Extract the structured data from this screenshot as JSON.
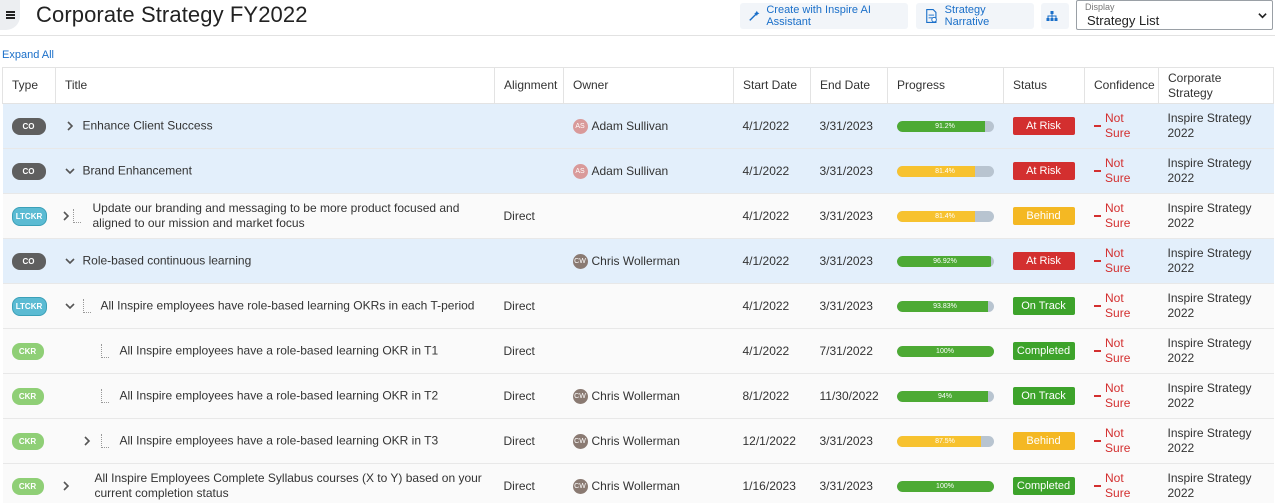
{
  "header": {
    "title": "Corporate Strategy FY2022",
    "ai_button": "Create with Inspire AI Assistant",
    "narrative_button": "Strategy Narrative",
    "display_label": "Display",
    "display_value": "Strategy List"
  },
  "expand_all": "Expand All",
  "columns": [
    "Type",
    "Title",
    "Alignment",
    "Owner",
    "Start Date",
    "End Date",
    "Progress",
    "Status",
    "Confidence",
    "Corporate Strategy"
  ],
  "rows": [
    {
      "type": "CO",
      "title": "Enhance Client Success",
      "alignment": "",
      "owner": "Adam Sullivan",
      "owner_initials": "AS",
      "start": "4/1/2022",
      "end": "3/31/2023",
      "progress_label": "91.2%",
      "progress": 0.912,
      "status": "At Risk",
      "confidence": "Not Sure",
      "strategy": "Inspire Strategy 2022"
    },
    {
      "type": "CO",
      "title": "Brand Enhancement",
      "alignment": "",
      "owner": "Adam Sullivan",
      "owner_initials": "AS",
      "start": "4/1/2022",
      "end": "3/31/2023",
      "progress_label": "81.4%",
      "progress": 0.814,
      "status": "At Risk",
      "confidence": "Not Sure",
      "strategy": "Inspire Strategy 2022"
    },
    {
      "type": "LTCKR",
      "title": "Update our branding and messaging to be more product focused and aligned to our mission and market focus",
      "alignment": "Direct",
      "owner": "",
      "owner_initials": "",
      "start": "4/1/2022",
      "end": "3/31/2023",
      "progress_label": "81.4%",
      "progress": 0.814,
      "status": "Behind",
      "confidence": "Not Sure",
      "strategy": "Inspire Strategy 2022"
    },
    {
      "type": "CO",
      "title": "Role-based continuous learning",
      "alignment": "",
      "owner": "Chris Wollerman",
      "owner_initials": "CW",
      "start": "4/1/2022",
      "end": "3/31/2023",
      "progress_label": "96.92%",
      "progress": 0.9692,
      "status": "At Risk",
      "confidence": "Not Sure",
      "strategy": "Inspire Strategy 2022"
    },
    {
      "type": "LTCKR",
      "title": "All Inspire employees have role-based learning OKRs in each T-period",
      "alignment": "Direct",
      "owner": "",
      "owner_initials": "",
      "start": "4/1/2022",
      "end": "3/31/2023",
      "progress_label": "93.83%",
      "progress": 0.9383,
      "status": "On Track",
      "confidence": "Not Sure",
      "strategy": "Inspire Strategy 2022"
    },
    {
      "type": "CKR",
      "title": "All Inspire employees have a role-based learning OKR in T1",
      "alignment": "Direct",
      "owner": "",
      "owner_initials": "",
      "start": "4/1/2022",
      "end": "7/31/2022",
      "progress_label": "100%",
      "progress": 1.0,
      "status": "Completed",
      "confidence": "Not Sure",
      "strategy": "Inspire Strategy 2022"
    },
    {
      "type": "CKR",
      "title": "All Inspire employees have a role-based learning OKR in T2",
      "alignment": "Direct",
      "owner": "Chris Wollerman",
      "owner_initials": "CW",
      "start": "8/1/2022",
      "end": "11/30/2022",
      "progress_label": "94%",
      "progress": 0.94,
      "status": "On Track",
      "confidence": "Not Sure",
      "strategy": "Inspire Strategy 2022"
    },
    {
      "type": "CKR",
      "title": "All Inspire employees have a role-based learning OKR in T3",
      "alignment": "Direct",
      "owner": "Chris Wollerman",
      "owner_initials": "CW",
      "start": "12/1/2022",
      "end": "3/31/2023",
      "progress_label": "87.5%",
      "progress": 0.875,
      "status": "Behind",
      "confidence": "Not Sure",
      "strategy": "Inspire Strategy 2022"
    },
    {
      "type": "CKR",
      "title": "All Inspire Employees Complete Syllabus courses (X to Y) based on your current completion status",
      "alignment": "Direct",
      "owner": "Chris Wollerman",
      "owner_initials": "CW",
      "start": "1/16/2023",
      "end": "3/31/2023",
      "progress_label": "100%",
      "progress": 1.0,
      "status": "Completed",
      "confidence": "Not Sure",
      "strategy": "Inspire Strategy 2022"
    }
  ],
  "colors": {
    "accent": "#1a6fc9",
    "highlight_row": "#e3effb",
    "at_risk": "#d32f2f",
    "behind": "#f4b823",
    "on_track": "#3da32b"
  },
  "icons": [
    "menu-icon",
    "magic-wand-icon",
    "document-icon",
    "hierarchy-icon",
    "chevron-down-icon",
    "chevron-right-icon"
  ]
}
